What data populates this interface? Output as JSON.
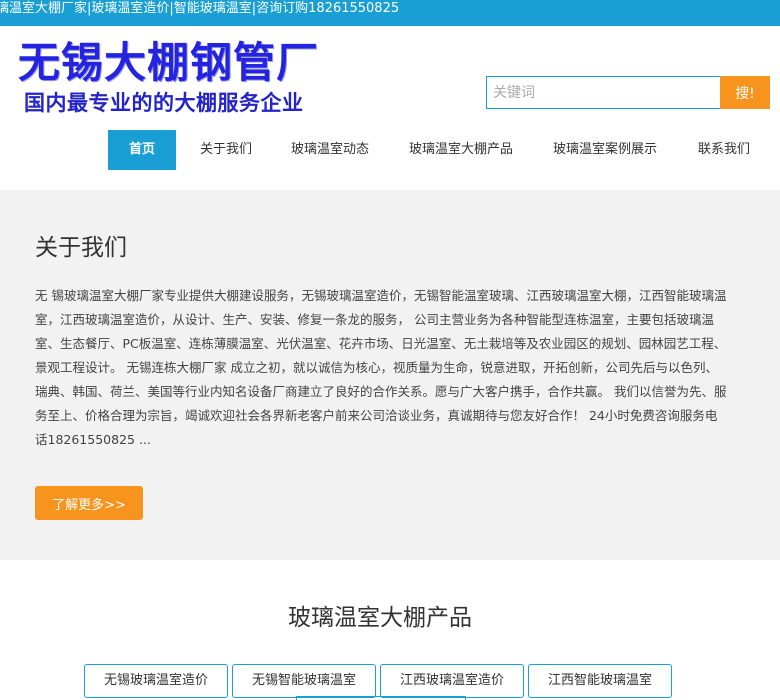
{
  "topbar": {
    "text": "璃温室大棚厂家|玻璃温室造价|智能玻璃温室|咨询订购18261550825"
  },
  "logo": {
    "line1": "无锡大棚钢管厂",
    "line2": "国内最专业的的大棚服务企业"
  },
  "search": {
    "placeholder": "关键词",
    "button_label": "搜!"
  },
  "nav": {
    "items": [
      {
        "label": "首页"
      },
      {
        "label": "关于我们"
      },
      {
        "label": "玻璃温室动态"
      },
      {
        "label": "玻璃温室大棚产品"
      },
      {
        "label": "玻璃温室案例展示"
      },
      {
        "label": "联系我们"
      }
    ]
  },
  "about": {
    "title": "关于我们",
    "text": "无 锡玻璃温室大棚厂家专业提供大棚建设服务，无锡玻璃温室造价，无锡智能温室玻璃、江西玻璃温室大棚，江西智能玻璃温室，江西玻璃温室造价，从设计、生产、安装、修复一条龙的服务， 公司主营业务为各种智能型连栋温室，主要包括玻璃温室、生态餐厅、PC板温室、连栋薄膜温室、光伏温室、花卉市场、日光温室、无土栽培等及农业园区的规划、园林园艺工程、景观工程设计。 无锡连栋大棚厂家 成立之初，就以诚信为核心，视质量为生命，锐意进取，开拓创新，公司先后与以色列、瑞典、韩国、荷兰、美国等行业内知名设备厂商建立了良好的合作关系。愿与广大客户携手，合作共赢。 我们以信誉为先、服务至上、价格合理为宗旨，竭诚欢迎社会各界新老客户前来公司洽谈业务，真诚期待与您友好合作！ 24小时免费咨询服务电话18261550825 ...",
    "more_label": "了解更多>>"
  },
  "products": {
    "title": "玻璃温室大棚产品",
    "tags": [
      {
        "label": "无锡玻璃温室造价"
      },
      {
        "label": "无锡智能玻璃温室"
      },
      {
        "label": "江西玻璃温室造价"
      },
      {
        "label": "江西智能玻璃温室"
      }
    ]
  },
  "colors": {
    "brand_blue": "#1a9fd4",
    "accent_orange": "#f7941d",
    "logo_blue": "#2424e0",
    "section_bg": "#f2f2f2"
  }
}
